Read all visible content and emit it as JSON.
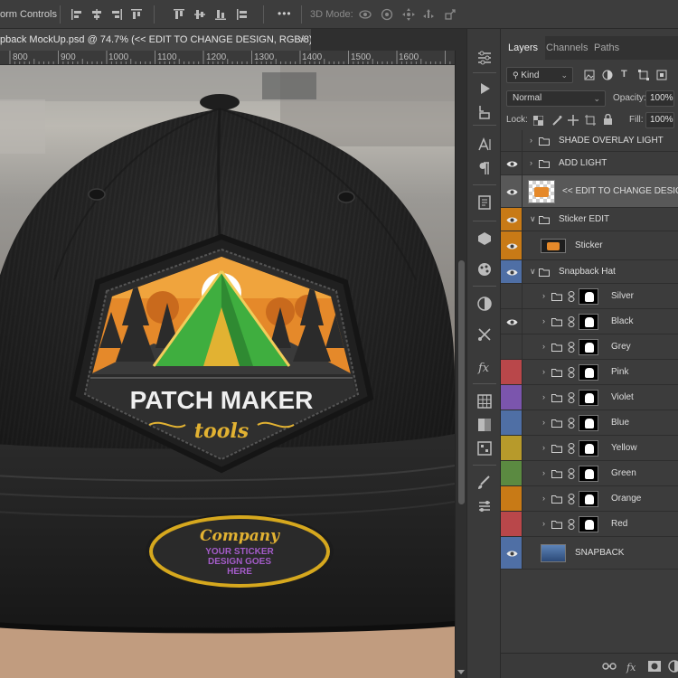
{
  "options_bar": {
    "transform_controls_label": "orm Controls",
    "mode_label": "3D Mode:",
    "more_label": "•••"
  },
  "document": {
    "tab_title": "pback MockUp.psd @ 74.7% (<<  EDIT TO CHANGE DESIGN, RGB/8) *",
    "close": "×"
  },
  "ruler": {
    "labels": [
      "800",
      "900",
      "1000",
      "1100",
      "1200",
      "1300",
      "1400",
      "1500",
      "1600"
    ]
  },
  "artwork": {
    "patch_title": "PATCH MAKER",
    "patch_subtitle": "tools",
    "sticker_company": "Company",
    "sticker_line1": "YOUR STICKER",
    "sticker_line2": "DESIGN GOES",
    "sticker_line3": "HERE"
  },
  "panel": {
    "tabs": [
      "Layers",
      "Channels",
      "Paths"
    ],
    "active_tab": "Layers",
    "filter_label": "Kind",
    "blend_mode": "Normal",
    "opacity_label": "Opacity:",
    "opacity_value": "100%",
    "lock_label": "Lock:",
    "fill_label": "Fill:",
    "fill_value": "100%"
  },
  "layers": [
    {
      "name": "SHADE OVERLAY LIGHT",
      "type": "group",
      "visible": false,
      "color": "",
      "selected": false
    },
    {
      "name": "ADD LIGHT",
      "type": "group",
      "visible": true,
      "color": "",
      "selected": false
    },
    {
      "name": "<<  EDIT TO CHANGE DESIGN",
      "type": "smart",
      "visible": true,
      "color": "",
      "selected": true
    },
    {
      "name": "Sticker EDIT",
      "type": "group-open",
      "visible": true,
      "color": "#c87a16",
      "selected": false
    },
    {
      "name": "Sticker",
      "type": "smart",
      "visible": true,
      "color": "#c87a16",
      "selected": false
    },
    {
      "name": "Snapback Hat",
      "type": "group-open",
      "visible": true,
      "color": "#4f6fa5",
      "selected": false
    },
    {
      "name": "Silver",
      "type": "masked",
      "visible": false,
      "color": "",
      "selected": false
    },
    {
      "name": "Black",
      "type": "masked",
      "visible": true,
      "color": "",
      "selected": false
    },
    {
      "name": "Grey",
      "type": "masked",
      "visible": false,
      "color": "",
      "selected": false
    },
    {
      "name": "Pink",
      "type": "masked",
      "visible": false,
      "color": "#b9474a",
      "selected": false
    },
    {
      "name": "Violet",
      "type": "masked",
      "visible": false,
      "color": "#7b55ad",
      "selected": false
    },
    {
      "name": "Blue",
      "type": "masked",
      "visible": false,
      "color": "#4f6fa5",
      "selected": false
    },
    {
      "name": "Yellow",
      "type": "masked",
      "visible": false,
      "color": "#b79a2b",
      "selected": false
    },
    {
      "name": "Green",
      "type": "masked",
      "visible": false,
      "color": "#5b8a41",
      "selected": false
    },
    {
      "name": "Orange",
      "type": "masked",
      "visible": false,
      "color": "#c87a16",
      "selected": false
    },
    {
      "name": "Red",
      "type": "masked",
      "visible": false,
      "color": "#b9474a",
      "selected": false
    },
    {
      "name": "SNAPBACK",
      "type": "image",
      "visible": true,
      "color": "#4f6fa5",
      "selected": false
    }
  ],
  "colors": {
    "ui_bg": "#3c3c3c",
    "selected_row": "#585858",
    "patch_orange": "#e5892a",
    "patch_green": "#3fae3f",
    "patch_gold": "#e2b232",
    "sticker_purple": "#a45cc9"
  }
}
